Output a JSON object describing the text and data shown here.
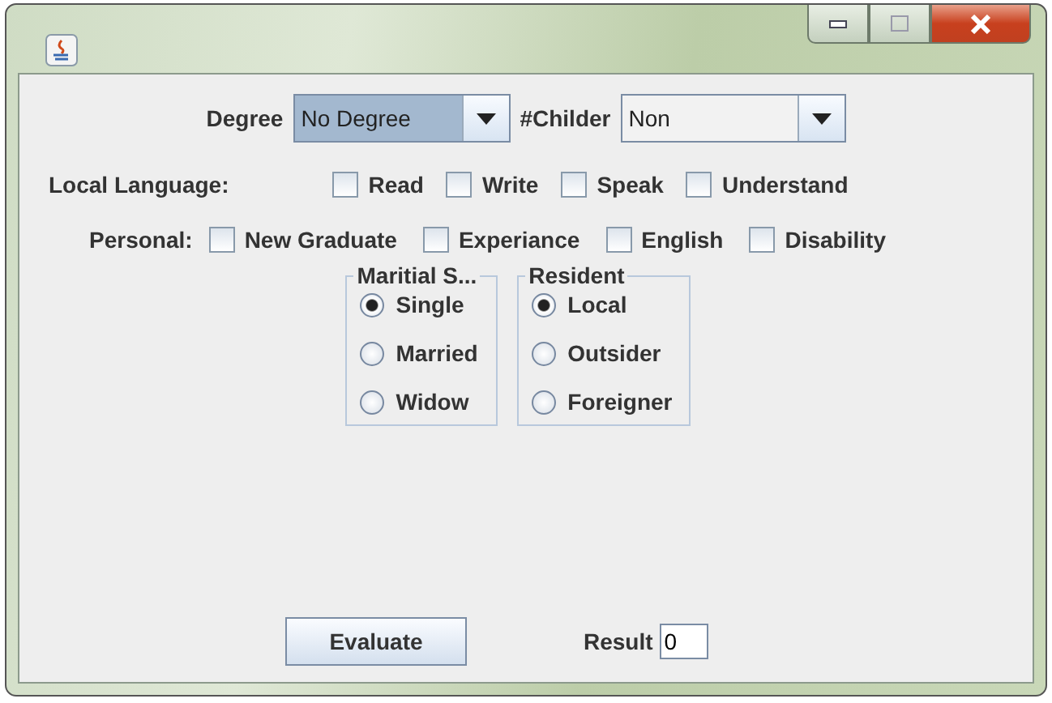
{
  "combos": [
    {
      "label": "Degree",
      "value": "No Degree",
      "focused": true
    },
    {
      "label": "#Childer",
      "value": "Non",
      "focused": false
    }
  ],
  "local_language": {
    "label": "Local Language:",
    "options": [
      {
        "label": "Read",
        "checked": false
      },
      {
        "label": "Write",
        "checked": false
      },
      {
        "label": "Speak",
        "checked": false
      },
      {
        "label": "Understand",
        "checked": false
      }
    ]
  },
  "personal": {
    "label": "Personal:",
    "options": [
      {
        "label": "New Graduate",
        "checked": false
      },
      {
        "label": "Experiance",
        "checked": false
      },
      {
        "label": "English",
        "checked": false
      },
      {
        "label": "Disability",
        "checked": false
      }
    ]
  },
  "groups": [
    {
      "title": "Maritial S...",
      "options": [
        {
          "label": "Single",
          "selected": true
        },
        {
          "label": "Married",
          "selected": false
        },
        {
          "label": "Widow",
          "selected": false
        }
      ]
    },
    {
      "title": "Resident",
      "options": [
        {
          "label": "Local",
          "selected": true
        },
        {
          "label": "Outsider",
          "selected": false
        },
        {
          "label": "Foreigner",
          "selected": false
        }
      ]
    }
  ],
  "evaluate_button": "Evaluate",
  "result": {
    "label": "Result",
    "value": "0"
  }
}
